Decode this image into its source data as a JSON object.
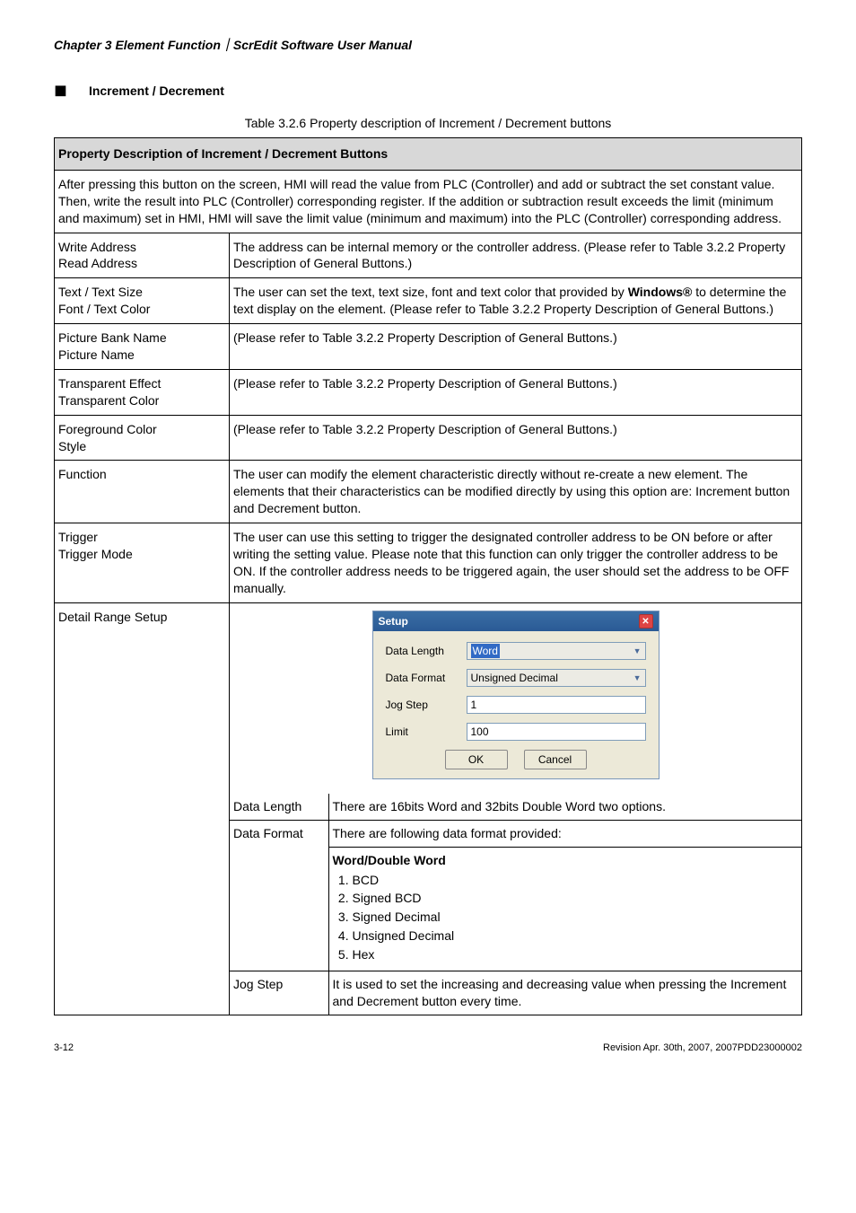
{
  "header": "Chapter 3  Element Function｜ScrEdit Software User Manual",
  "section_title": "Increment / Decrement",
  "table_caption": "Table 3.2.6 Property description of Increment / Decrement buttons",
  "table_header": "Property Description of Increment / Decrement Buttons",
  "intro": "After pressing this button on the screen, HMI will read the value from PLC (Controller) and add or subtract the set constant value. Then, write the result into PLC  (Controller) corresponding register. If the addition or subtraction result exceeds the limit (minimum and maximum) set in HMI, HMI will save the limit value (minimum and maximum) into the PLC (Controller) corresponding address.",
  "rows": {
    "r1": {
      "label_a": "Write Address",
      "label_b": "Read Address",
      "desc": "The address can be internal memory or the controller address. (Please refer to Table 3.2.2 Property Description of General Buttons.)"
    },
    "r2": {
      "label_a": "Text / Text Size",
      "label_b": "Font / Text Color",
      "desc_a": "The user can set the text, text size, font and text color that provided by ",
      "desc_bold": "Windows®",
      "desc_b": " to determine the text display on the element. (Please refer to Table 3.2.2 Property Description of General Buttons.)"
    },
    "r3": {
      "label_a": "Picture Bank Name",
      "label_b": "Picture Name",
      "desc": "(Please refer to Table 3.2.2 Property Description of General Buttons.)"
    },
    "r4": {
      "label_a": "Transparent Effect",
      "label_b": "Transparent Color",
      "desc": "(Please refer to Table 3.2.2 Property Description of General Buttons.)"
    },
    "r5": {
      "label_a": "Foreground Color",
      "label_b": "Style",
      "desc": "(Please refer to Table 3.2.2 Property Description of General Buttons.)"
    },
    "r6": {
      "label": "Function",
      "desc": "The user can modify the element characteristic directly without re-create a new element. The elements that their characteristics can be modified directly by using this option are: Increment button and Decrement button."
    },
    "r7": {
      "label_a": "Trigger",
      "label_b": "Trigger Mode",
      "desc": "The user can use this setting to trigger the designated controller address to be ON before or after writing the setting value. Please note that this function can only trigger the controller address to be ON. If the controller address needs to be triggered again, the user should set the address to be OFF manually."
    },
    "r8": {
      "label": "Detail Range Setup"
    }
  },
  "dialog": {
    "title": "Setup",
    "l1": "Data Length",
    "v1": "Word",
    "l2": "Data Format",
    "v2": "Unsigned Decimal",
    "l3": "Jog Step",
    "v3": "1",
    "l4": "Limit",
    "v4": "100",
    "ok": "OK",
    "cancel": "Cancel"
  },
  "inner": {
    "r1": {
      "label": "Data Length",
      "desc": "There are 16bits Word and 32bits Double Word two options."
    },
    "r2": {
      "label": "Data Format",
      "desc_intro": "There are following data format provided:",
      "heading": "Word/Double Word",
      "items": {
        "i1": "BCD",
        "i2": "Signed BCD",
        "i3": "Signed Decimal",
        "i4": "Unsigned Decimal",
        "i5": "Hex"
      }
    },
    "r3": {
      "label": "Jog Step",
      "desc": "It is used to set the increasing and decreasing value when pressing the Increment and Decrement button every time."
    }
  },
  "footer": {
    "left": "3-12",
    "right": "Revision Apr. 30th, 2007, 2007PDD23000002"
  }
}
